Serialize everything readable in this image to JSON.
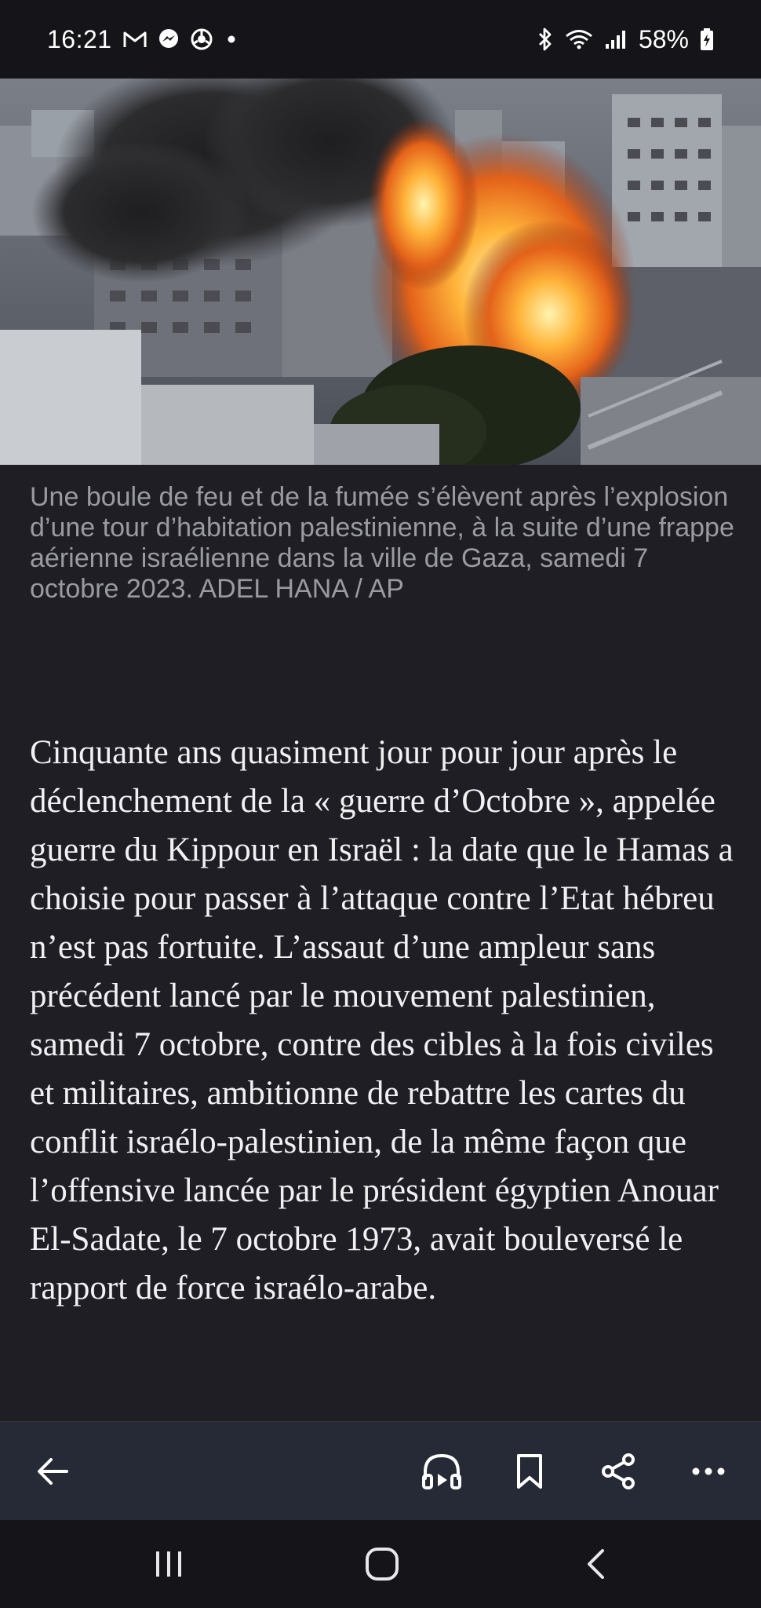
{
  "status_bar": {
    "time": "16:21",
    "notification_icons": [
      "gmail-icon",
      "messenger-icon",
      "chrome-icon",
      "dot-icon"
    ],
    "battery": "58%"
  },
  "hero_image": {
    "description_icon": "photo-explosion-gaza"
  },
  "caption": {
    "text": "Une boule de feu et de la fumée s’élèvent après l’explosion d’une tour d’habitation palestinienne, à la suite d’une frappe aérienne israélienne dans la ville de Gaza, samedi 7 octobre 2023. ADEL HANA / AP"
  },
  "article": {
    "paragraph": "Cinquante ans quasiment jour pour jour après le déclenchement de la « guerre d’Octobre », appelée guerre du Kippour en Israël : la date que le Hamas a choisie pour passer à l’attaque contre l’Etat hébreu n’est pas fortuite. L’assaut d’une ampleur sans précédent lancé par le mouvement palestinien, samedi 7 octobre, contre des cibles à la fois civiles et militaires, ambitionne de rebattre les cartes du conflit israélo-palestinien, de la même façon que l’offensive lancée par le président égyptien Anouar El-Sadate, le 7 octobre 1973, avait bouleversé le rapport de force israélo-arabe."
  },
  "toolbar": {
    "icons": [
      "back-arrow-icon",
      "listen-audio-icon",
      "bookmark-icon",
      "share-icon",
      "more-icon"
    ]
  },
  "system_nav": {
    "icons": [
      "recent-apps-icon",
      "home-icon",
      "system-back-icon"
    ]
  },
  "colors": {
    "background": "#1e1e24",
    "toolbar": "#262a36",
    "caption_text": "#9a9aa2",
    "body_text": "#f1f1f3"
  }
}
